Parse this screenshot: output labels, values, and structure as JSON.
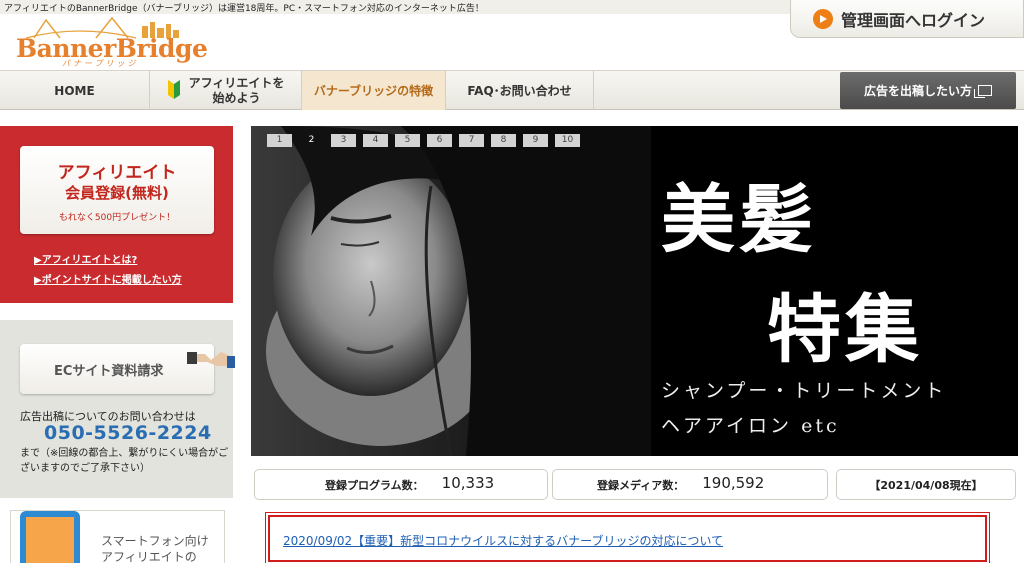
{
  "header": {
    "tagline": "アフィリエイトのBannerBridge（バナーブリッジ）は運営18周年。PC・スマートフォン対応のインターネット広告！",
    "login_label": "管理画面へログイン",
    "logo_text": "BannerBridge",
    "logo_kana": "バナーブリッジ",
    "accent_color": "#e7802c"
  },
  "nav": {
    "home": "HOME",
    "start_line1": "アフィリエイトを",
    "start_line2": "始めよう",
    "features": "バナーブリッジの特徴",
    "faq": "FAQ･お問い合わせ",
    "advertise": "広告を出稿したい方"
  },
  "sidebar": {
    "aff_title": "アフィリエイト",
    "aff_subtitle": "会員登録(無料)",
    "aff_gift": "もれなく500円プレゼント！",
    "aff_link1": "▶アフィリエイトとは?",
    "aff_link2": "▶ポイントサイトに掲載したい方",
    "ec_button": "ECサイト資料請求",
    "ec_question": "広告出稿についてのお問い合わせは",
    "ec_phone": "050-5526-2224",
    "ec_note": "まで（※回線の都合上、繋がりにくい場合がございますのでご了承下さい）",
    "sp_line1": "スマートフォン向け",
    "sp_line2": "アフィリエイトの"
  },
  "hero": {
    "pages": [
      "1",
      "2",
      "3",
      "4",
      "5",
      "6",
      "7",
      "8",
      "9",
      "10"
    ],
    "active_page": "2",
    "headline1": "美髪",
    "headline2": "特集",
    "sub1": "シャンプー・トリートメント",
    "sub2": "ヘアアイロン etc"
  },
  "stats": {
    "program_label": "登録プログラム数：",
    "program_value": "10,333",
    "media_label": "登録メディア数：",
    "media_value": "190,592",
    "as_of": "【2021/04/08現在】"
  },
  "notice": {
    "link_text": "2020/09/02【重要】新型コロナウイルスに対するバナーブリッジの対応について"
  }
}
